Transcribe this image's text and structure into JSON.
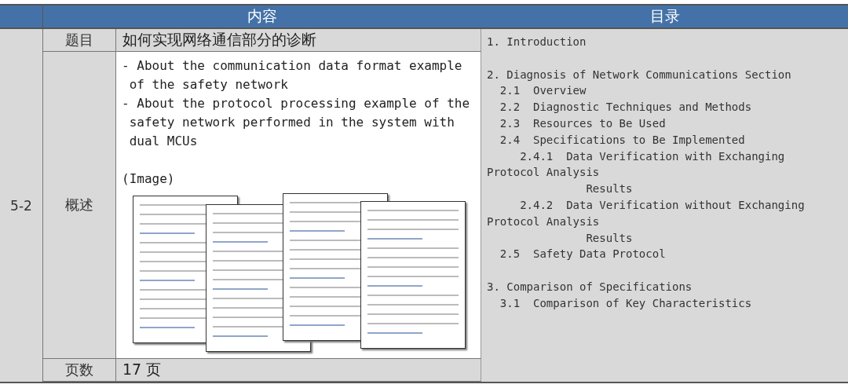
{
  "header": {
    "content": "内容",
    "toc": "目录"
  },
  "section": "5-2",
  "rows": [
    {
      "kind": "text",
      "label": "题目",
      "value": "如何实现网络通信部分的诊断"
    },
    {
      "kind": "summary",
      "label": "概述",
      "bullets": [
        "- About the communication data format example of the safety network",
        "- About the protocol processing example of the safety network performed in the system with dual MCUs"
      ],
      "image_label": "(Image)"
    },
    {
      "kind": "text",
      "label": "页数",
      "value": "17 页"
    }
  ],
  "toc": [
    {
      "number": "1.",
      "title": "Introduction"
    },
    {
      "number": "2.",
      "title": "Diagnosis of Network Communications Section",
      "children": [
        {
          "number": "2.1",
          "title": "Overview"
        },
        {
          "number": "2.2",
          "title": "Diagnostic Techniques and Methods"
        },
        {
          "number": "2.3",
          "title": "Resources to Be Used"
        },
        {
          "number": "2.4",
          "title": "Specifications to Be Implemented",
          "children": [
            {
              "number": "2.4.1",
              "title_lines": [
                "Data Verification with Exchanging",
                "Protocol Analysis",
                "Results"
              ]
            },
            {
              "number": "2.4.2",
              "title_lines": [
                "Data Verification without Exchanging",
                "Protocol Analysis",
                "Results"
              ]
            }
          ]
        },
        {
          "number": "2.5",
          "title": "Safety Data Protocol"
        }
      ]
    },
    {
      "number": "3.",
      "title": "Comparison of Specifications",
      "children": [
        {
          "number": "3.1",
          "title": "Comparison of Key Characteristics"
        }
      ]
    }
  ]
}
